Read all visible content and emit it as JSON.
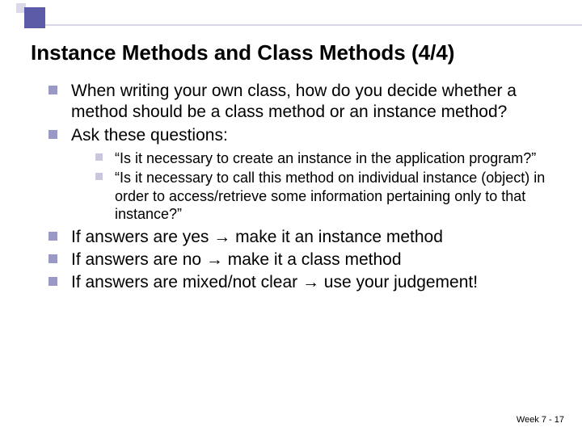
{
  "title": "Instance Methods and Class Methods (4/4)",
  "bullets": {
    "b0": "When writing your own class, how do you decide whether a method should be a class method or an instance method?",
    "b1": "Ask these questions:",
    "sub0": "“Is it necessary to create an instance in the application program?”",
    "sub1": "“Is it necessary to call this method on individual instance (object) in order to access/retrieve some information pertaining only to that instance?”",
    "b2": "If answers are yes → make it an instance method",
    "b3": "If answers are no → make it a class method",
    "b4": "If answers are mixed/not clear → use your judgement!"
  },
  "footer": "Week 7 - 17"
}
